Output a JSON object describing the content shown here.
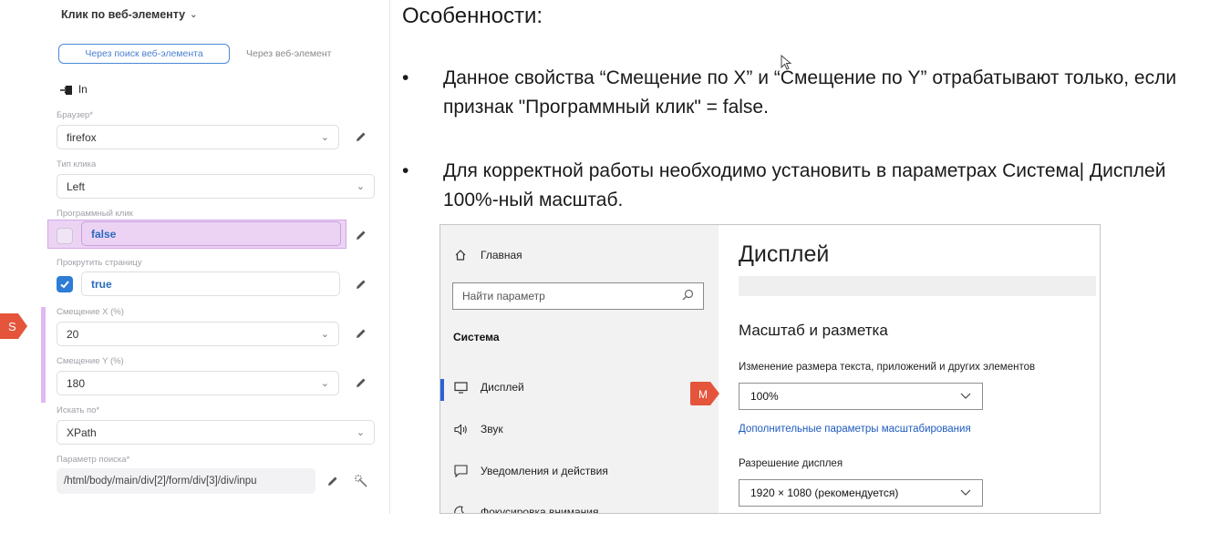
{
  "panel": {
    "title": "Клик по веб-элементу",
    "tabs": [
      {
        "label": "Через поиск веб-элемента",
        "active": true
      },
      {
        "label": "Через веб-элемент",
        "active": false
      }
    ],
    "port_label": "In",
    "fields": {
      "browser": {
        "label": "Браузер*",
        "value": "firefox"
      },
      "click_type": {
        "label": "Тип клика",
        "value": "Left"
      },
      "programmatic_click": {
        "label": "Программный клик",
        "value": "false",
        "checked": false
      },
      "scroll_page": {
        "label": "Прокрутить страницу",
        "value": "true",
        "checked": true
      },
      "offset_x": {
        "label": "Смещение X (%)",
        "value": "20"
      },
      "offset_y": {
        "label": "Смещение Y (%)",
        "value": "180"
      },
      "search_by": {
        "label": "Искать по*",
        "value": "XPath"
      },
      "search_param": {
        "label": "Параметр поиска*",
        "value": "/html/body/main/div[2]/form/div[3]/div/inpu"
      }
    },
    "marker_label": "S",
    "accent_color": "#2d7cd6",
    "highlight_color": "#ecd3f4"
  },
  "slide": {
    "title": "Особенности:",
    "bullets": [
      "Данное свойства “Смещение по X” и “Смещение по Y” отрабатывают только, если признак \"Программный клик\" = false.",
      "Для корректной работы необходимо установить в параметрах Система| Дисплей 100%-ный масштаб."
    ],
    "bullet_symbol": "•"
  },
  "settings": {
    "sidebar": {
      "home": "Главная",
      "search_placeholder": "Найти параметр",
      "section": "Система",
      "items": [
        "Дисплей",
        "Звук",
        "Уведомления и действия",
        "Фокусировка внимания"
      ]
    },
    "main": {
      "title": "Дисплей",
      "section_title": "Масштаб и разметка",
      "scale_label": "Изменение размера текста, приложений и других элементов",
      "scale_value": "100%",
      "advanced_link": "Дополнительные параметры масштабирования",
      "resolution_label": "Разрешение дисплея",
      "resolution_value": "1920 × 1080 (рекомендуется)"
    },
    "marker_label": "M",
    "marker_color": "#e4553b"
  }
}
